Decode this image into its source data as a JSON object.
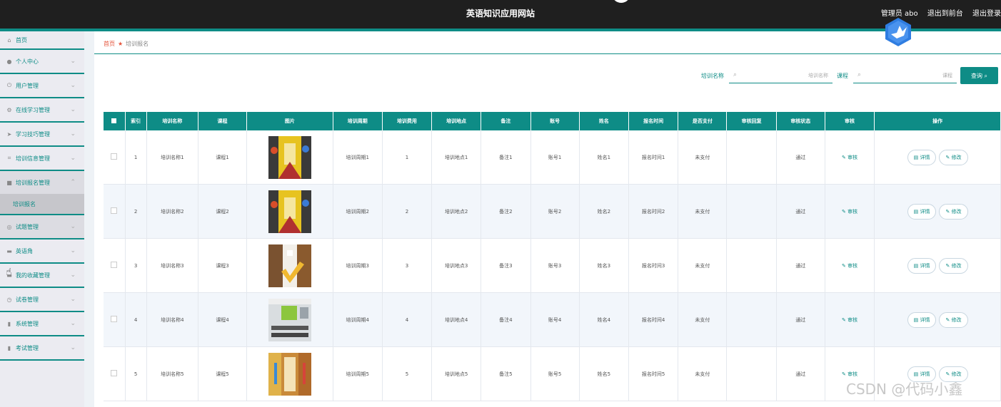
{
  "header": {
    "site_title": "英语知识应用网站",
    "admin_label": "管理员 abo",
    "link_front": "退出到前台",
    "link_logout": "退出登录"
  },
  "sidebar": {
    "items": [
      {
        "label": "首页",
        "icon": "home-icon"
      },
      {
        "label": "个人中心",
        "icon": "user-icon"
      },
      {
        "label": "用户管理",
        "icon": "power-icon"
      },
      {
        "label": "在线学习管理",
        "icon": "gear-icon"
      },
      {
        "label": "学习技巧管理",
        "icon": "send-icon"
      },
      {
        "label": "培训信息管理",
        "icon": "crop-icon"
      },
      {
        "label": "培训报名管理",
        "icon": "chat-icon"
      },
      {
        "label": "试题管理",
        "icon": "globe-icon"
      },
      {
        "label": "英语角",
        "icon": "briefcase-icon"
      },
      {
        "label": "我的收藏管理",
        "icon": "folder-icon"
      },
      {
        "label": "试卷管理",
        "icon": "clock-icon"
      },
      {
        "label": "系统管理",
        "icon": "trash-icon"
      },
      {
        "label": "考试管理",
        "icon": "trash-icon"
      }
    ],
    "sub_item": "培训报名"
  },
  "breadcrumb": {
    "home": "首页",
    "current": "培训报名"
  },
  "search": {
    "name_label": "培训名称",
    "name_placeholder": "培训名称",
    "course_label": "课程",
    "course_placeholder": "课程",
    "button": "查询"
  },
  "table": {
    "headers": [
      "索引",
      "培训名称",
      "课程",
      "图片",
      "培训周期",
      "培训费用",
      "培训地点",
      "备注",
      "账号",
      "姓名",
      "报名时间",
      "是否支付",
      "审核回复",
      "审核状态",
      "审核",
      "操作"
    ],
    "rows": [
      {
        "idx": "1",
        "name": "培训名称1",
        "course": "课程1",
        "period": "培训周期1",
        "fee": "1",
        "place": "培训地点1",
        "note": "备注1",
        "account": "账号1",
        "person": "姓名1",
        "time": "报名时间1",
        "paid": "未支付",
        "reply": "",
        "status": "通过",
        "audit": "审核",
        "detail": "详情",
        "edit": "修改"
      },
      {
        "idx": "2",
        "name": "培训名称2",
        "course": "课程2",
        "period": "培训周期2",
        "fee": "2",
        "place": "培训地点2",
        "note": "备注2",
        "account": "账号2",
        "person": "姓名2",
        "time": "报名时间2",
        "paid": "未支付",
        "reply": "",
        "status": "通过",
        "audit": "审核",
        "detail": "详情",
        "edit": "修改"
      },
      {
        "idx": "3",
        "name": "培训名称3",
        "course": "课程3",
        "period": "培训周期3",
        "fee": "3",
        "place": "培训地点3",
        "note": "备注3",
        "account": "账号3",
        "person": "姓名3",
        "time": "报名时间3",
        "paid": "未支付",
        "reply": "",
        "status": "通过",
        "audit": "审核",
        "detail": "详情",
        "edit": "修改"
      },
      {
        "idx": "4",
        "name": "培训名称4",
        "course": "课程4",
        "period": "培训周期4",
        "fee": "4",
        "place": "培训地点4",
        "note": "备注4",
        "account": "账号4",
        "person": "姓名4",
        "time": "报名时间4",
        "paid": "未支付",
        "reply": "",
        "status": "通过",
        "audit": "审核",
        "detail": "详情",
        "edit": "修改"
      },
      {
        "idx": "5",
        "name": "培训名称5",
        "course": "课程5",
        "period": "培训周期5",
        "fee": "5",
        "place": "培训地点5",
        "note": "备注5",
        "account": "账号5",
        "person": "姓名5",
        "time": "报名时间5",
        "paid": "未支付",
        "reply": "",
        "status": "通过",
        "audit": "审核",
        "detail": "详情",
        "edit": "修改"
      }
    ]
  },
  "watermark": "CSDN @代码小鑫",
  "colors": {
    "accent": "#0e8c86",
    "topbar": "#1f1f1f",
    "breadcrumb_home": "#e5533a"
  }
}
